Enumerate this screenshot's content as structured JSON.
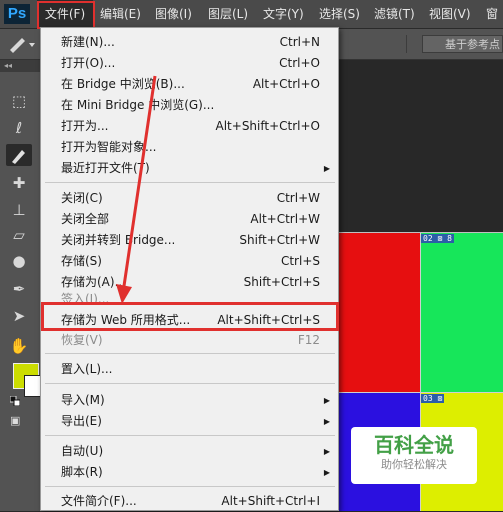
{
  "app": {
    "logo": "Ps"
  },
  "menubar": {
    "items": [
      {
        "label": "文件(F)"
      },
      {
        "label": "编辑(E)"
      },
      {
        "label": "图像(I)"
      },
      {
        "label": "图层(L)"
      },
      {
        "label": "文字(Y)"
      },
      {
        "label": "选择(S)"
      },
      {
        "label": "滤镜(T)"
      },
      {
        "label": "视图(V)"
      },
      {
        "label": "窗"
      }
    ]
  },
  "options_bar": {
    "base_field": "基于参考点"
  },
  "toolbox": {
    "collapse": "◂◂",
    "tools": [
      "marquee-icon",
      "lasso-icon",
      "brush-icon",
      "healing-icon",
      "stamp-icon",
      "eraser-icon",
      "drop-icon",
      "pen-icon",
      "path-select-icon",
      "hand-icon"
    ],
    "foreground_color": "#ccdd00",
    "background_color": "#ffffff"
  },
  "canvas": {
    "cells": [
      {
        "color": "#e60f10"
      },
      {
        "color": "#17e65a"
      },
      {
        "color": "#2b10e0"
      },
      {
        "color": "#ddee00"
      }
    ],
    "slice_labels": [
      "02 ⊠ 8",
      "03 ⊠"
    ]
  },
  "file_menu": {
    "items": [
      {
        "label": "新建(N)...",
        "shortcut": "Ctrl+N"
      },
      {
        "label": "打开(O)...",
        "shortcut": "Ctrl+O"
      },
      {
        "label": "在 Bridge 中浏览(B)...",
        "shortcut": "Alt+Ctrl+O"
      },
      {
        "label": "在 Mini Bridge 中浏览(G)...",
        "shortcut": ""
      },
      {
        "label": "打开为...",
        "shortcut": "Alt+Shift+Ctrl+O"
      },
      {
        "label": "打开为智能对象...",
        "shortcut": ""
      },
      {
        "label": "最近打开文件(T)",
        "shortcut": ""
      },
      {
        "label": "关闭(C)",
        "shortcut": "Ctrl+W"
      },
      {
        "label": "关闭全部",
        "shortcut": "Alt+Ctrl+W"
      },
      {
        "label": "关闭并转到 Bridge...",
        "shortcut": "Shift+Ctrl+W"
      },
      {
        "label": "存储(S)",
        "shortcut": "Ctrl+S"
      },
      {
        "label": "存储为(A)...",
        "shortcut": "Shift+Ctrl+S"
      },
      {
        "label": "签入(I)...",
        "shortcut": ""
      },
      {
        "label": "存储为 Web 所用格式...",
        "shortcut": "Alt+Shift+Ctrl+S"
      },
      {
        "label": "恢复(V)",
        "shortcut": "F12"
      },
      {
        "label": "置入(L)...",
        "shortcut": ""
      },
      {
        "label": "导入(M)",
        "shortcut": ""
      },
      {
        "label": "导出(E)",
        "shortcut": ""
      },
      {
        "label": "自动(U)",
        "shortcut": ""
      },
      {
        "label": "脚本(R)",
        "shortcut": ""
      },
      {
        "label": "文件简介(F)...",
        "shortcut": "Alt+Shift+Ctrl+I"
      }
    ]
  },
  "watermark": {
    "title": "百科全说",
    "subtitle": "助你轻松解决"
  },
  "colors": {
    "annotation": "#e0302e",
    "menu_bg": "#f0f0f0",
    "app_bg": "#535353"
  }
}
